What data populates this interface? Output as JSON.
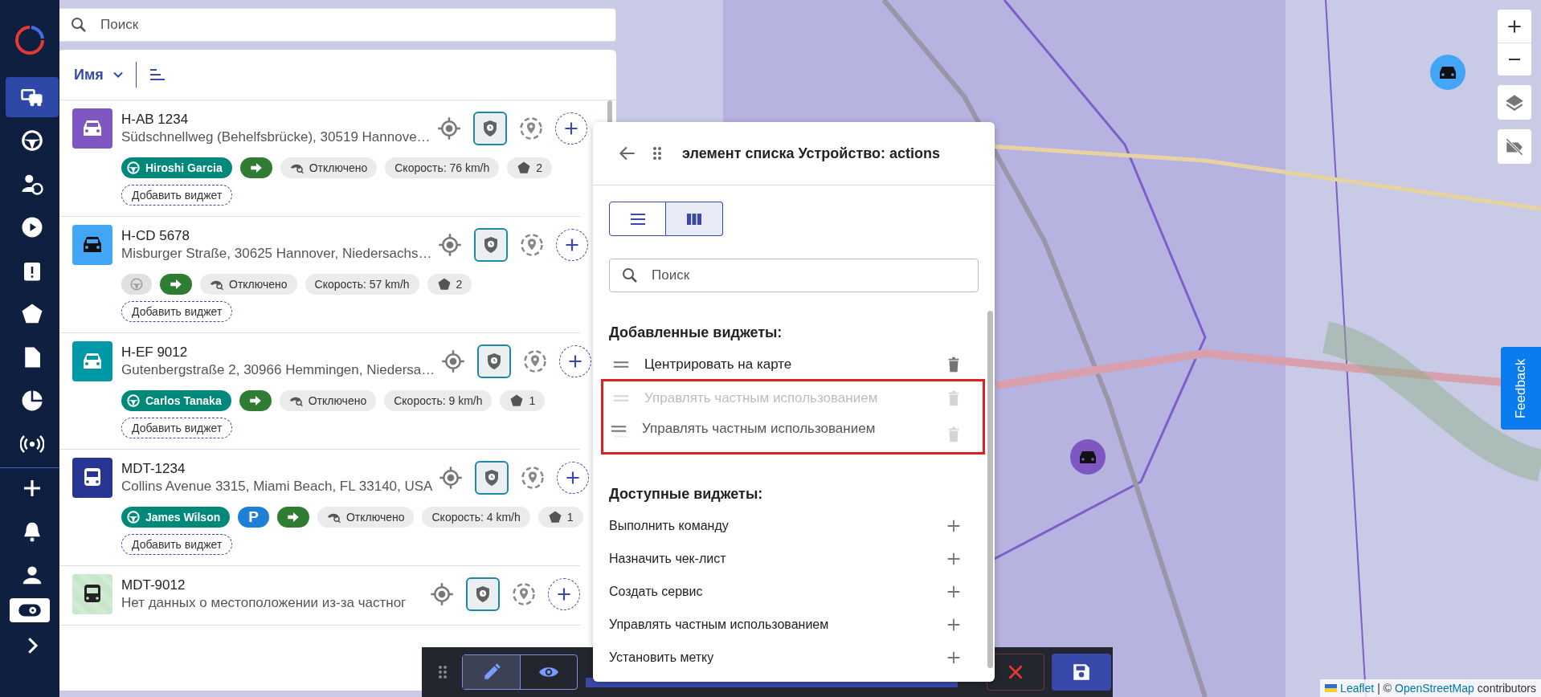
{
  "sidebar": {
    "items": [
      {
        "kind": "fleet",
        "selected": true,
        "active": false
      },
      {
        "kind": "wheel",
        "selected": false,
        "active": false
      },
      {
        "kind": "driver",
        "selected": false,
        "active": false
      },
      {
        "kind": "play",
        "selected": false,
        "active": false
      },
      {
        "kind": "clipboard",
        "selected": false,
        "active": false
      },
      {
        "kind": "pentagon",
        "selected": false,
        "active": false
      },
      {
        "kind": "document",
        "selected": false,
        "active": false
      },
      {
        "kind": "pie",
        "selected": false,
        "active": false
      },
      {
        "kind": "broadcast",
        "selected": false,
        "active": false
      },
      {
        "kind": "plus",
        "selected": false,
        "active": false
      },
      {
        "kind": "bell",
        "selected": false,
        "active": false
      },
      {
        "kind": "person",
        "selected": false,
        "active": false
      },
      {
        "kind": "settings",
        "selected": false,
        "active": true
      },
      {
        "kind": "chevron",
        "selected": false,
        "active": false
      }
    ]
  },
  "search": {
    "placeholder": "Поиск"
  },
  "list": {
    "sort_label": "Имя",
    "vehicles": [
      {
        "plate": "H-AB 1234",
        "address": "Südschnellweg (Behelfsbrücke), 30519 Hannove…",
        "color": "#7e57c2",
        "kind": "car",
        "location_hidden": false,
        "chips": [
          {
            "kind": "driver",
            "text": "Hiroshi Garcia"
          },
          {
            "kind": "direction"
          },
          {
            "kind": "privacy",
            "text": "Отключено"
          },
          {
            "kind": "speed",
            "text": "Скорость: 76 km/h"
          },
          {
            "kind": "geofence",
            "text": "2"
          },
          {
            "kind": "add",
            "text": "Добавить виджет"
          }
        ]
      },
      {
        "plate": "H-CD 5678",
        "address": "Misburger Straße, 30625 Hannover, Niedersachs…",
        "color": "#42a5f5",
        "kind": "car",
        "location_hidden": false,
        "chips": [
          {
            "kind": "no-driver"
          },
          {
            "kind": "direction"
          },
          {
            "kind": "privacy",
            "text": "Отключено"
          },
          {
            "kind": "speed",
            "text": "Скорость: 57 km/h"
          },
          {
            "kind": "geofence",
            "text": "2"
          },
          {
            "kind": "add",
            "text": "Добавить виджет"
          }
        ]
      },
      {
        "plate": "H-EF 9012",
        "address": "Gutenbergstraße 2, 30966 Hemmingen, Niedersa…",
        "color": "#0097a7",
        "kind": "car",
        "location_hidden": false,
        "chips": [
          {
            "kind": "driver",
            "text": "Carlos Tanaka"
          },
          {
            "kind": "direction"
          },
          {
            "kind": "privacy",
            "text": "Отключено"
          },
          {
            "kind": "speed",
            "text": "Скорость: 9 km/h"
          },
          {
            "kind": "geofence",
            "text": "1"
          },
          {
            "kind": "add",
            "text": "Добавить виджет"
          }
        ]
      },
      {
        "plate": "MDT-1234",
        "address": "Collins Avenue 3315, Miami Beach, FL 33140, USA",
        "color": "#283593",
        "kind": "bus",
        "location_hidden": false,
        "chips": [
          {
            "kind": "driver",
            "text": "James Wilson"
          },
          {
            "kind": "parking",
            "text": "P"
          },
          {
            "kind": "direction"
          },
          {
            "kind": "privacy",
            "text": "Отключено"
          },
          {
            "kind": "speed",
            "text": "Скорость: 4 km/h"
          },
          {
            "kind": "geofence",
            "text": "1"
          },
          {
            "kind": "add",
            "text": "Добавить виджет"
          }
        ]
      },
      {
        "plate": "MDT-9012",
        "address": "Нет данных о местоположении из-за частног",
        "color": "#c8e6c9",
        "kind": "bus",
        "location_hidden": true
      }
    ]
  },
  "panel": {
    "title": "элемент списка Устройство: actions",
    "views": [
      {
        "kind": "list",
        "selected": false
      },
      {
        "kind": "columns",
        "selected": true
      }
    ],
    "search": {
      "placeholder": "Поиск"
    },
    "added_title": "Добавленные виджеты:",
    "added": [
      {
        "label": "Центрировать на карте",
        "kind": "normal"
      },
      {
        "label": "Управлять частным использованием",
        "kind": "placeholder"
      },
      {
        "kind": "covered"
      }
    ],
    "dragging": {
      "label": "Управлять частным использованием"
    },
    "available_title": "Доступные виджеты:",
    "available": [
      {
        "label": "Выполнить команду"
      },
      {
        "label": "Назначить чек-лист"
      },
      {
        "label": "Создать сервис"
      },
      {
        "label": "Управлять частным использованием"
      },
      {
        "label": "Установить метку"
      }
    ]
  },
  "toolbar": {
    "modes": [
      {
        "kind": "edit",
        "selected": true
      },
      {
        "kind": "view",
        "selected": false
      }
    ]
  },
  "map": {
    "markers": [
      {
        "color": "#42a5f5"
      },
      {
        "color": "#7e57c2"
      }
    ],
    "feedback": "Feedback",
    "attribution": {
      "link_1": "Leaflet",
      "separator": "| ©",
      "link_2": "OpenStreetMap",
      "text": "contributors"
    }
  }
}
